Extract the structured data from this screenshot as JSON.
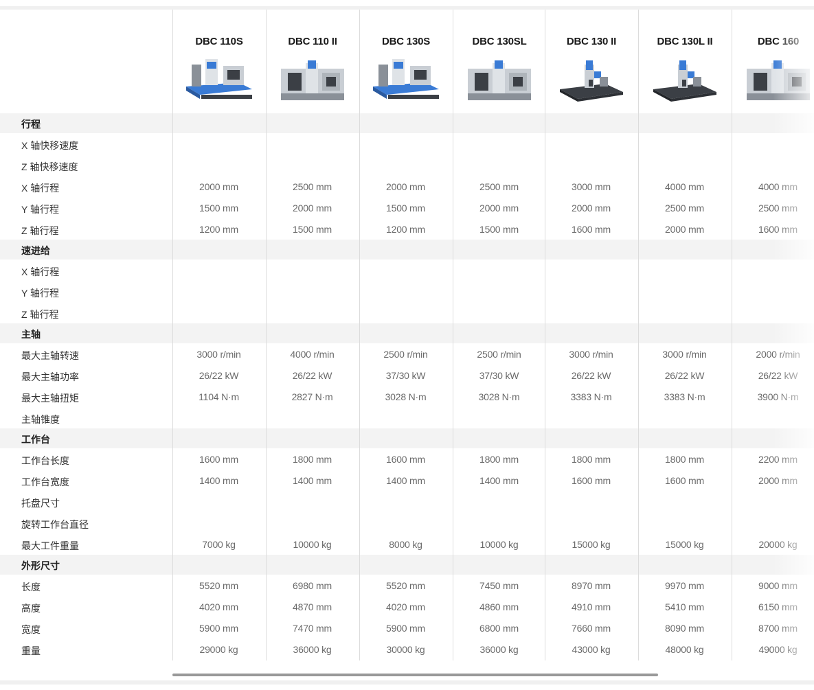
{
  "models": [
    {
      "name": "DBC 110S",
      "image": "machine-110s"
    },
    {
      "name": "DBC 110 II",
      "image": "machine-110ii"
    },
    {
      "name": "DBC 130S",
      "image": "machine-130s"
    },
    {
      "name": "DBC 130SL",
      "image": "machine-130sl"
    },
    {
      "name": "DBC 130 II",
      "image": "machine-130ii"
    },
    {
      "name": "DBC 130L II",
      "image": "machine-130lii"
    },
    {
      "name": "DBC 160",
      "image": "machine-160"
    }
  ],
  "rows": [
    {
      "label": "行程",
      "section": true,
      "values": []
    },
    {
      "label": "X 轴快移速度",
      "section": false,
      "values": [
        "",
        "",
        "",
        "",
        "",
        "",
        ""
      ]
    },
    {
      "label": "Z 轴快移速度",
      "section": false,
      "values": [
        "",
        "",
        "",
        "",
        "",
        "",
        ""
      ]
    },
    {
      "label": "X 轴行程",
      "section": false,
      "values": [
        "2000 mm",
        "2500 mm",
        "2000 mm",
        "2500 mm",
        "3000 mm",
        "4000 mm",
        "4000 mm"
      ]
    },
    {
      "label": "Y 轴行程",
      "section": false,
      "values": [
        "1500 mm",
        "2000 mm",
        "1500 mm",
        "2000 mm",
        "2000 mm",
        "2500 mm",
        "2500 mm"
      ]
    },
    {
      "label": "Z 轴行程",
      "section": false,
      "values": [
        "1200 mm",
        "1500 mm",
        "1200 mm",
        "1500 mm",
        "1600 mm",
        "2000 mm",
        "1600 mm"
      ]
    },
    {
      "label": "速进给",
      "section": true,
      "values": []
    },
    {
      "label": "X 轴行程",
      "section": false,
      "values": [
        "",
        "",
        "",
        "",
        "",
        "",
        ""
      ]
    },
    {
      "label": "Y 轴行程",
      "section": false,
      "values": [
        "",
        "",
        "",
        "",
        "",
        "",
        ""
      ]
    },
    {
      "label": "Z 轴行程",
      "section": false,
      "values": [
        "",
        "",
        "",
        "",
        "",
        "",
        ""
      ]
    },
    {
      "label": "主轴",
      "section": true,
      "values": []
    },
    {
      "label": "最大主轴转速",
      "section": false,
      "values": [
        "3000 r/min",
        "4000 r/min",
        "2500 r/min",
        "2500 r/min",
        "3000 r/min",
        "3000 r/min",
        "2000 r/min"
      ]
    },
    {
      "label": "最大主轴功率",
      "section": false,
      "values": [
        "26/22 kW",
        "26/22 kW",
        "37/30 kW",
        "37/30 kW",
        "26/22 kW",
        "26/22 kW",
        "26/22 kW"
      ]
    },
    {
      "label": "最大主轴扭矩",
      "section": false,
      "values": [
        "1104 N·m",
        "2827 N·m",
        "3028 N·m",
        "3028 N·m",
        "3383 N·m",
        "3383 N·m",
        "3900 N·m"
      ]
    },
    {
      "label": "主轴锥度",
      "section": false,
      "values": [
        "",
        "",
        "",
        "",
        "",
        "",
        ""
      ]
    },
    {
      "label": "工作台",
      "section": true,
      "values": []
    },
    {
      "label": "工作台长度",
      "section": false,
      "values": [
        "1600 mm",
        "1800 mm",
        "1600 mm",
        "1800 mm",
        "1800 mm",
        "1800 mm",
        "2200 mm"
      ]
    },
    {
      "label": "工作台宽度",
      "section": false,
      "values": [
        "1400 mm",
        "1400 mm",
        "1400 mm",
        "1400 mm",
        "1600 mm",
        "1600 mm",
        "2000 mm"
      ]
    },
    {
      "label": "托盘尺寸",
      "section": false,
      "values": [
        "",
        "",
        "",
        "",
        "",
        "",
        ""
      ]
    },
    {
      "label": "旋转工作台直径",
      "section": false,
      "values": [
        "",
        "",
        "",
        "",
        "",
        "",
        ""
      ]
    },
    {
      "label": "最大工件重量",
      "section": false,
      "values": [
        "7000 kg",
        "10000 kg",
        "8000 kg",
        "10000 kg",
        "15000 kg",
        "15000 kg",
        "20000 kg"
      ]
    },
    {
      "label": "外形尺寸",
      "section": true,
      "values": []
    },
    {
      "label": "长度",
      "section": false,
      "values": [
        "5520 mm",
        "6980 mm",
        "5520 mm",
        "7450 mm",
        "8970 mm",
        "9970 mm",
        "9000 mm"
      ]
    },
    {
      "label": "高度",
      "section": false,
      "values": [
        "4020 mm",
        "4870 mm",
        "4020 mm",
        "4860 mm",
        "4910 mm",
        "5410 mm",
        "6150 mm"
      ]
    },
    {
      "label": "宽度",
      "section": false,
      "values": [
        "5900 mm",
        "7470 mm",
        "5900 mm",
        "6800 mm",
        "7660 mm",
        "8090 mm",
        "8700 mm"
      ]
    },
    {
      "label": "重量",
      "section": false,
      "values": [
        "29000 kg",
        "36000 kg",
        "30000 kg",
        "36000 kg",
        "43000 kg",
        "48000 kg",
        "49000 kg"
      ]
    }
  ],
  "colors": {
    "section_bg": "#f3f3f3",
    "value_text": "#6a6a6a",
    "divider": "#dcdcdc",
    "scroll_thumb": "#999999"
  }
}
